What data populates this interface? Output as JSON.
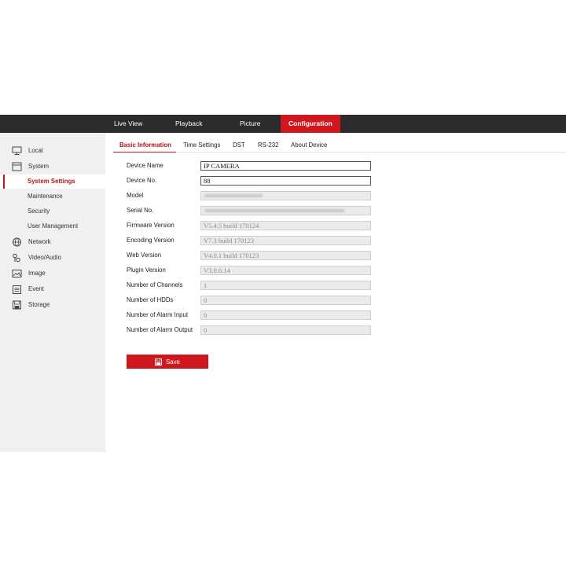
{
  "topnav": {
    "items": [
      {
        "label": "Live View"
      },
      {
        "label": "Playback"
      },
      {
        "label": "Picture"
      },
      {
        "label": "Configuration",
        "active": true
      }
    ]
  },
  "sidebar": {
    "items": [
      {
        "label": "Local",
        "icon": "monitor-icon"
      },
      {
        "label": "System",
        "icon": "system-icon"
      },
      {
        "label": "System Settings",
        "active": true
      },
      {
        "label": "Maintenance"
      },
      {
        "label": "Security"
      },
      {
        "label": "User Management"
      },
      {
        "label": "Network",
        "icon": "globe-icon"
      },
      {
        "label": "Video/Audio",
        "icon": "video-audio-icon"
      },
      {
        "label": "Image",
        "icon": "image-icon"
      },
      {
        "label": "Event",
        "icon": "event-icon"
      },
      {
        "label": "Storage",
        "icon": "storage-icon"
      }
    ]
  },
  "tabs": [
    {
      "label": "Basic Information",
      "active": true
    },
    {
      "label": "Time Settings"
    },
    {
      "label": "DST"
    },
    {
      "label": "RS-232"
    },
    {
      "label": "About Device"
    }
  ],
  "form": {
    "fields": [
      {
        "label": "Device Name",
        "value": "IP CAMERA"
      },
      {
        "label": "Device No.",
        "value": "88"
      },
      {
        "label": "Model",
        "value": ""
      },
      {
        "label": "Serial No.",
        "value": ""
      },
      {
        "label": "Firmware Version",
        "value": "V5.4.5 build 170124"
      },
      {
        "label": "Encoding Version",
        "value": "V7.3 build 170123"
      },
      {
        "label": "Web Version",
        "value": "V4.0.1 build 170123"
      },
      {
        "label": "Plugin Version",
        "value": "V3.0.6.14"
      },
      {
        "label": "Number of Channels",
        "value": "1"
      },
      {
        "label": "Number of HDDs",
        "value": "0"
      },
      {
        "label": "Number of Alarm Input",
        "value": "0"
      },
      {
        "label": "Number of Alarm Output",
        "value": "0"
      }
    ]
  },
  "actions": {
    "save_label": "Save"
  },
  "colors": {
    "accent": "#d0171e",
    "topbar": "#2b2b2b",
    "sidebar": "#f0f0f0"
  }
}
